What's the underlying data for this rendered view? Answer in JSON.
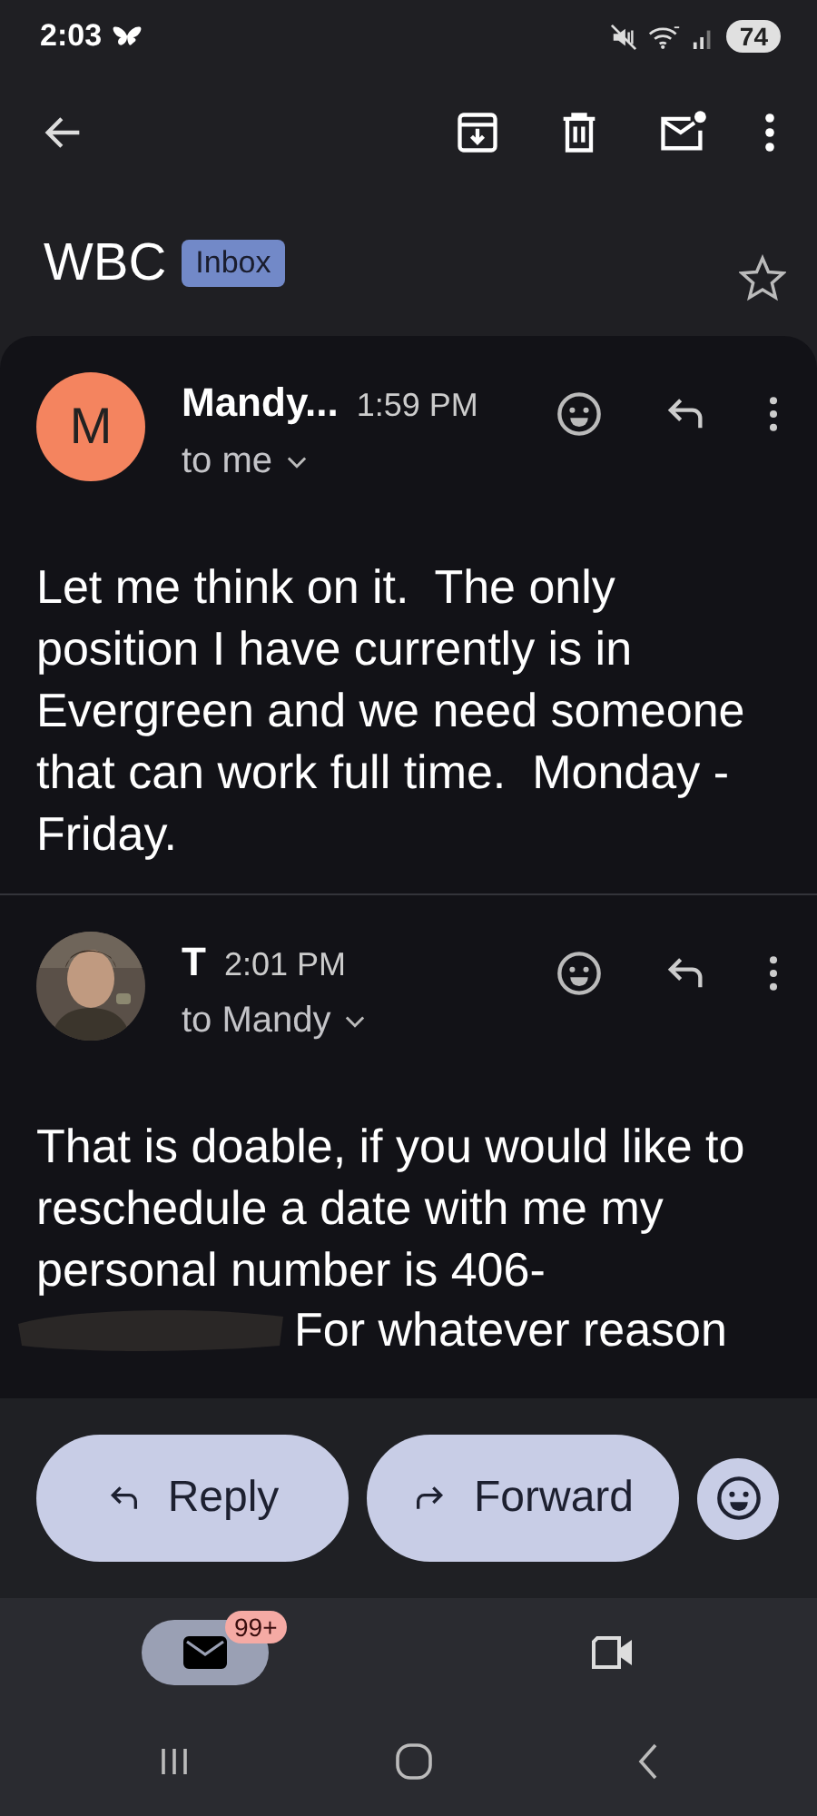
{
  "status_bar": {
    "time": "2:03",
    "battery": "74"
  },
  "subject": {
    "title": "WBC",
    "label": "Inbox",
    "starred": false
  },
  "messages": [
    {
      "avatar": {
        "kind": "letter",
        "letter": "M",
        "color": "#f4845f"
      },
      "sender": "Mandy...",
      "time": "1:59 PM",
      "recipients": "to me",
      "body": "Let me think on it.  The only position I have currently is in Evergreen and we need someone that can work full time.  Monday - Friday."
    },
    {
      "sender": "T",
      "time": "2:01 PM",
      "recipients": "to Mandy",
      "body": "That is doable, if you would like to reschedule a date with me my personal number is 406-",
      "redacted": true,
      "body_after_redaction": "For whatever reason"
    }
  ],
  "actions": [
    {
      "kind": "reply",
      "label": "Reply"
    },
    {
      "kind": "forward",
      "label": "Forward"
    }
  ],
  "bottom_nav": [
    {
      "kind": "mail",
      "selected": true,
      "badge": "99+"
    },
    {
      "kind": "video",
      "selected": false
    }
  ]
}
